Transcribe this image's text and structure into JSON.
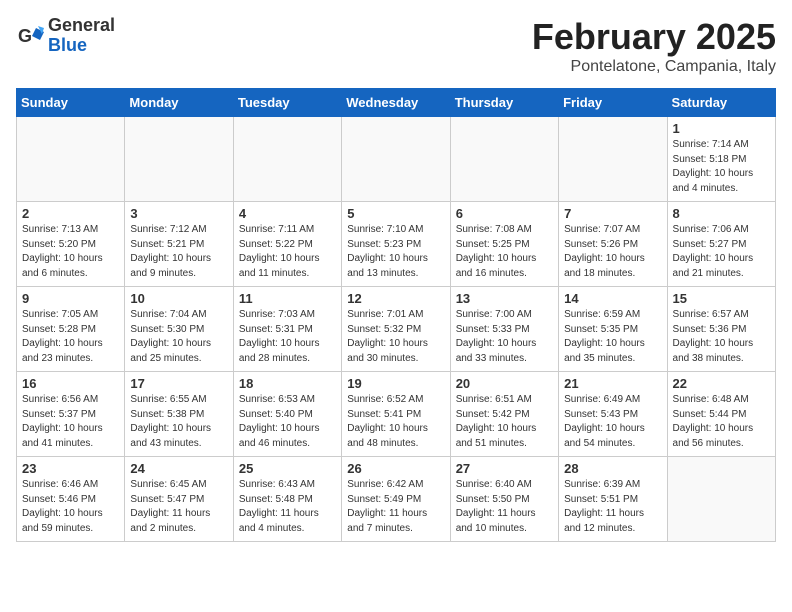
{
  "header": {
    "logo_line1": "General",
    "logo_line2": "Blue",
    "main_title": "February 2025",
    "subtitle": "Pontelatone, Campania, Italy"
  },
  "days_of_week": [
    "Sunday",
    "Monday",
    "Tuesday",
    "Wednesday",
    "Thursday",
    "Friday",
    "Saturday"
  ],
  "weeks": [
    [
      {
        "day": "",
        "info": ""
      },
      {
        "day": "",
        "info": ""
      },
      {
        "day": "",
        "info": ""
      },
      {
        "day": "",
        "info": ""
      },
      {
        "day": "",
        "info": ""
      },
      {
        "day": "",
        "info": ""
      },
      {
        "day": "1",
        "info": "Sunrise: 7:14 AM\nSunset: 5:18 PM\nDaylight: 10 hours and 4 minutes."
      }
    ],
    [
      {
        "day": "2",
        "info": "Sunrise: 7:13 AM\nSunset: 5:20 PM\nDaylight: 10 hours and 6 minutes."
      },
      {
        "day": "3",
        "info": "Sunrise: 7:12 AM\nSunset: 5:21 PM\nDaylight: 10 hours and 9 minutes."
      },
      {
        "day": "4",
        "info": "Sunrise: 7:11 AM\nSunset: 5:22 PM\nDaylight: 10 hours and 11 minutes."
      },
      {
        "day": "5",
        "info": "Sunrise: 7:10 AM\nSunset: 5:23 PM\nDaylight: 10 hours and 13 minutes."
      },
      {
        "day": "6",
        "info": "Sunrise: 7:08 AM\nSunset: 5:25 PM\nDaylight: 10 hours and 16 minutes."
      },
      {
        "day": "7",
        "info": "Sunrise: 7:07 AM\nSunset: 5:26 PM\nDaylight: 10 hours and 18 minutes."
      },
      {
        "day": "8",
        "info": "Sunrise: 7:06 AM\nSunset: 5:27 PM\nDaylight: 10 hours and 21 minutes."
      }
    ],
    [
      {
        "day": "9",
        "info": "Sunrise: 7:05 AM\nSunset: 5:28 PM\nDaylight: 10 hours and 23 minutes."
      },
      {
        "day": "10",
        "info": "Sunrise: 7:04 AM\nSunset: 5:30 PM\nDaylight: 10 hours and 25 minutes."
      },
      {
        "day": "11",
        "info": "Sunrise: 7:03 AM\nSunset: 5:31 PM\nDaylight: 10 hours and 28 minutes."
      },
      {
        "day": "12",
        "info": "Sunrise: 7:01 AM\nSunset: 5:32 PM\nDaylight: 10 hours and 30 minutes."
      },
      {
        "day": "13",
        "info": "Sunrise: 7:00 AM\nSunset: 5:33 PM\nDaylight: 10 hours and 33 minutes."
      },
      {
        "day": "14",
        "info": "Sunrise: 6:59 AM\nSunset: 5:35 PM\nDaylight: 10 hours and 35 minutes."
      },
      {
        "day": "15",
        "info": "Sunrise: 6:57 AM\nSunset: 5:36 PM\nDaylight: 10 hours and 38 minutes."
      }
    ],
    [
      {
        "day": "16",
        "info": "Sunrise: 6:56 AM\nSunset: 5:37 PM\nDaylight: 10 hours and 41 minutes."
      },
      {
        "day": "17",
        "info": "Sunrise: 6:55 AM\nSunset: 5:38 PM\nDaylight: 10 hours and 43 minutes."
      },
      {
        "day": "18",
        "info": "Sunrise: 6:53 AM\nSunset: 5:40 PM\nDaylight: 10 hours and 46 minutes."
      },
      {
        "day": "19",
        "info": "Sunrise: 6:52 AM\nSunset: 5:41 PM\nDaylight: 10 hours and 48 minutes."
      },
      {
        "day": "20",
        "info": "Sunrise: 6:51 AM\nSunset: 5:42 PM\nDaylight: 10 hours and 51 minutes."
      },
      {
        "day": "21",
        "info": "Sunrise: 6:49 AM\nSunset: 5:43 PM\nDaylight: 10 hours and 54 minutes."
      },
      {
        "day": "22",
        "info": "Sunrise: 6:48 AM\nSunset: 5:44 PM\nDaylight: 10 hours and 56 minutes."
      }
    ],
    [
      {
        "day": "23",
        "info": "Sunrise: 6:46 AM\nSunset: 5:46 PM\nDaylight: 10 hours and 59 minutes."
      },
      {
        "day": "24",
        "info": "Sunrise: 6:45 AM\nSunset: 5:47 PM\nDaylight: 11 hours and 2 minutes."
      },
      {
        "day": "25",
        "info": "Sunrise: 6:43 AM\nSunset: 5:48 PM\nDaylight: 11 hours and 4 minutes."
      },
      {
        "day": "26",
        "info": "Sunrise: 6:42 AM\nSunset: 5:49 PM\nDaylight: 11 hours and 7 minutes."
      },
      {
        "day": "27",
        "info": "Sunrise: 6:40 AM\nSunset: 5:50 PM\nDaylight: 11 hours and 10 minutes."
      },
      {
        "day": "28",
        "info": "Sunrise: 6:39 AM\nSunset: 5:51 PM\nDaylight: 11 hours and 12 minutes."
      },
      {
        "day": "",
        "info": ""
      }
    ]
  ]
}
